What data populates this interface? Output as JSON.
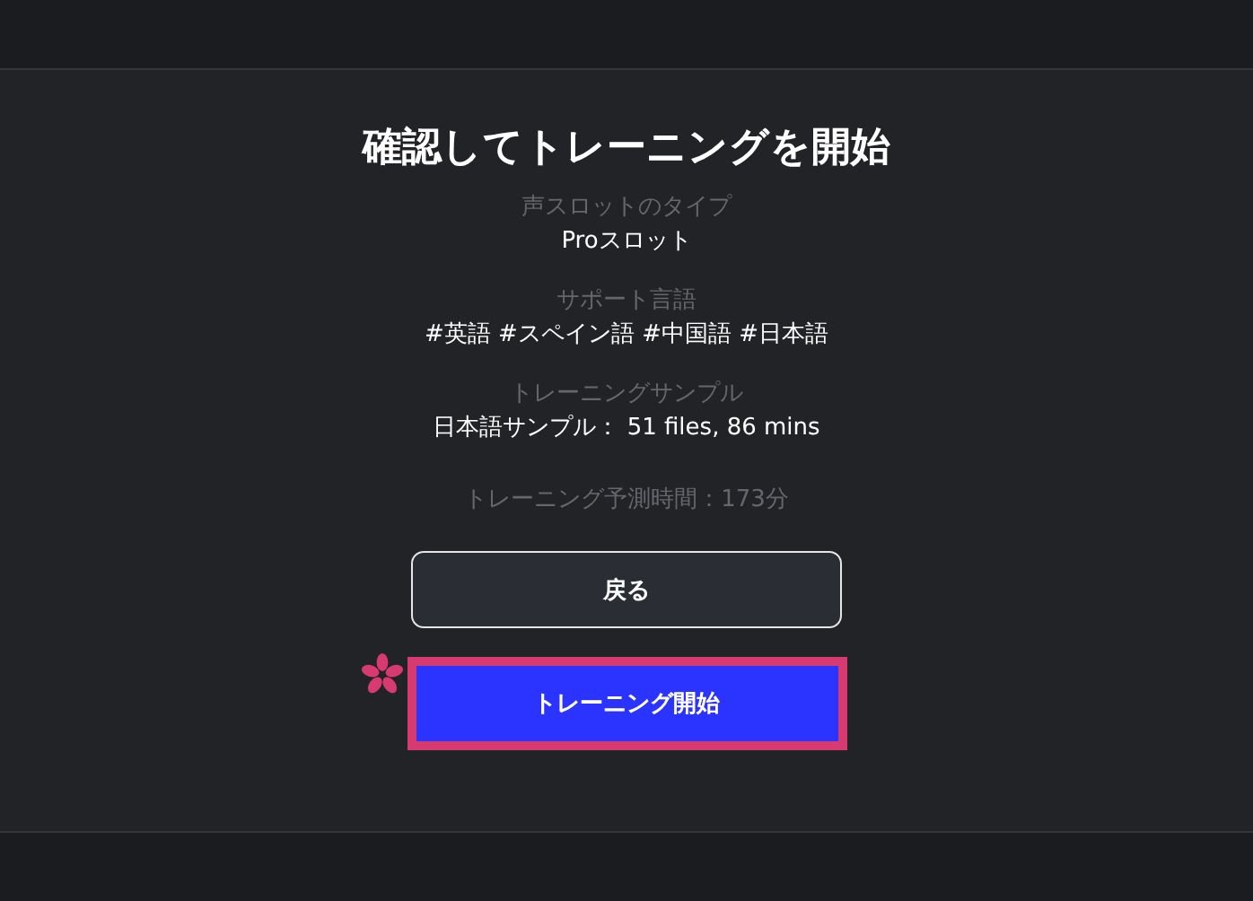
{
  "title": "確認してトレーニングを開始",
  "fields": [
    {
      "label": "声スロットのタイプ",
      "value": "Proスロット"
    },
    {
      "label": "サポート言語",
      "value": "#英語 #スペイン語 #中国語 #日本語"
    },
    {
      "label": "トレーニングサンプル",
      "value": "日本語サンプル： 51 files, 86 mins"
    }
  ],
  "estimate": "トレーニング予測時間：173分",
  "buttons": [
    {
      "label": "戻る",
      "kind": "secondary",
      "highlighted": false
    },
    {
      "label": "トレーニング開始",
      "kind": "primary",
      "highlighted": true
    }
  ]
}
